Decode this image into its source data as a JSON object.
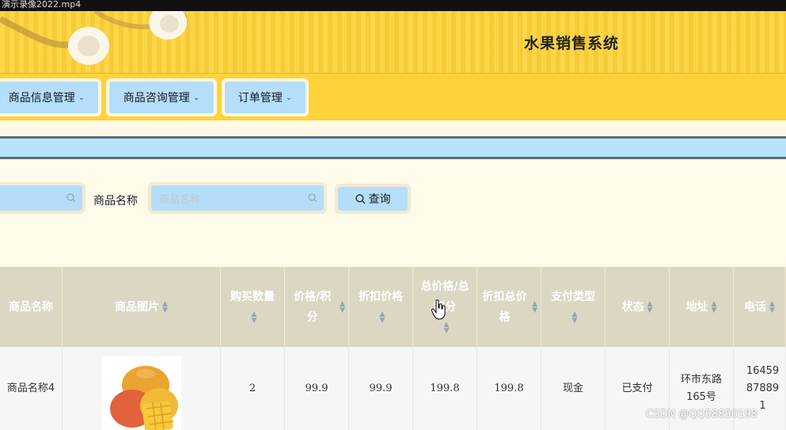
{
  "window": {
    "title": "演示录像2022.mp4"
  },
  "header": {
    "app_title": "水果销售系统"
  },
  "nav": [
    {
      "label": "商品信息管理",
      "icon": "chevron-down-icon"
    },
    {
      "label": "商品咨询管理",
      "icon": "chevron-down-icon"
    },
    {
      "label": "订单管理",
      "icon": "chevron-down-icon"
    }
  ],
  "search": {
    "field2_label": "商品名称",
    "field2_placeholder": "商品名称",
    "query_button": "查询"
  },
  "table": {
    "columns": [
      "商品名称",
      "商品图片",
      "购买数量",
      "价格/积分",
      "折扣价格",
      "总价格/总积分",
      "折扣总价格",
      "支付类型",
      "状态",
      "地址",
      "电话"
    ],
    "rows": [
      {
        "name": "商品名称4",
        "image": "mango-image",
        "quantity": "2",
        "price": "99.9",
        "discount_price": "99.9",
        "total": "199.8",
        "discount_total": "199.8",
        "pay_type": "现金",
        "status": "已支付",
        "address": "环市东路165号",
        "phone": "16459878891"
      }
    ]
  },
  "watermark": "CSDN @QQ58850198"
}
